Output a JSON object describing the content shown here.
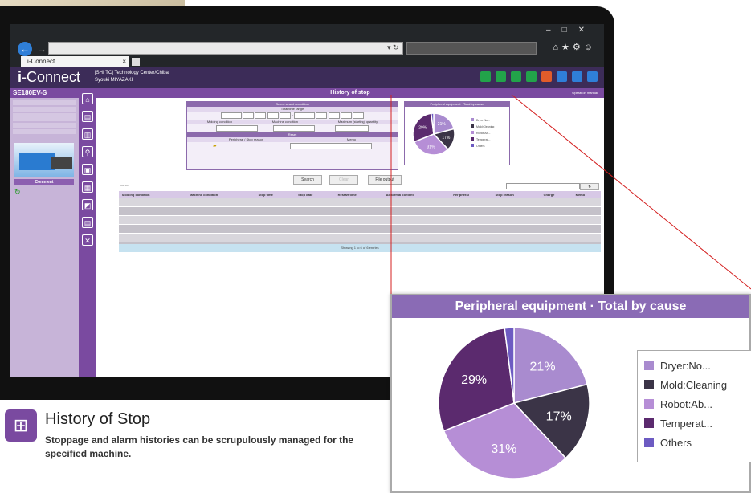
{
  "browser": {
    "tab_title": "i-Connect",
    "tab_close": "×"
  },
  "app": {
    "logo_prefix": "i",
    "logo_rest": "-Connect",
    "site": "[SHI TC] Technology Center/Chiba",
    "user": "Syouki MIYAZAKI",
    "header_icon_colors": [
      "#22a34a",
      "#22a34a",
      "#22a34a",
      "#22a34a",
      "#e25c2a",
      "#2f7fd8",
      "#2f7fd8",
      "#2f7fd8"
    ]
  },
  "machine": {
    "name": "SE180EV-S",
    "comment_button": "Comment"
  },
  "page": {
    "title": "History of stop",
    "operation_manual": "Operation manual"
  },
  "search_condition": {
    "title": "Select search condition",
    "time_range_label": "Total time range",
    "molding_condition_label": "Molding condition",
    "machine_condition_label": "Machine condition",
    "maximum_quantity_label": "Maximum (starting) quantity",
    "reset_label": "Reset",
    "peripheral_label": "Peripheral / Stop reason",
    "memo_label": "Memo"
  },
  "buttons": {
    "search": "Search",
    "clear": "Clear",
    "file_output": "File output"
  },
  "table": {
    "headers": [
      "Molding condition",
      "Machine condition",
      "Stop time",
      "Stop date",
      "Restart time",
      "Abnormal content",
      "Peripheral",
      "Stop reason",
      "Charge",
      "Memo"
    ],
    "footer": "Showing 1 to 6 of 6 entries"
  },
  "zoom_chart": {
    "title": "Peripheral equipment · Total by cause",
    "legend_items": [
      {
        "label": "Dryer:No...",
        "color": "#a98bcf"
      },
      {
        "label": "Mold:Cleaning",
        "color": "#3b3447"
      },
      {
        "label": "Robot:Ab...",
        "color": "#b68ed6"
      },
      {
        "label": "Temperat...",
        "color": "#5b2a6e"
      },
      {
        "label": "Others",
        "color": "#6d5bc2"
      }
    ]
  },
  "chart_data": {
    "type": "pie",
    "title": "Peripheral equipment · Total by cause",
    "categories": [
      "Dryer:No...",
      "Mold:Cleaning",
      "Robot:Ab...",
      "Temperat...",
      "Others"
    ],
    "values": [
      21,
      17,
      31,
      29,
      2
    ],
    "labels": [
      "21%",
      "17%",
      "31%",
      "29%",
      ""
    ],
    "colors": [
      "#a98bcf",
      "#3b3447",
      "#b68ed6",
      "#5b2a6e",
      "#6d5bc2"
    ],
    "legend": "right"
  },
  "caption": {
    "title": "History of Stop",
    "description": "Stoppage and alarm histories can be scrupulously managed for the specified machine."
  }
}
